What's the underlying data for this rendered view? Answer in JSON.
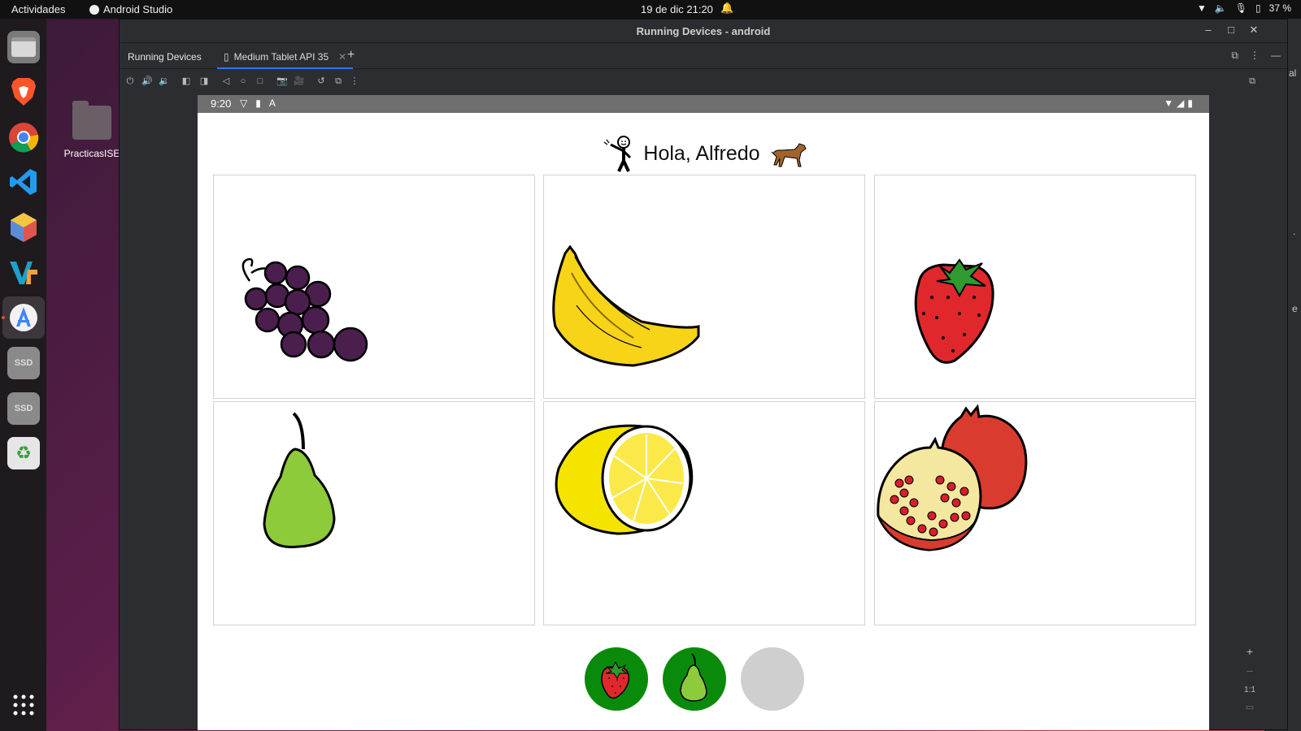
{
  "topbar": {
    "activities": "Actividades",
    "app_name": "Android Studio",
    "clock": "19 de dic  21:20",
    "battery": "37 %"
  },
  "desktop": {
    "folder_label": "PracticasISE"
  },
  "dock": {
    "items": [
      "files",
      "brave",
      "chrome",
      "vscode",
      "gem-app",
      "vs-app",
      "android-studio",
      "ssd-1",
      "ssd-2",
      "trash"
    ],
    "ssd_label": "SSD"
  },
  "window": {
    "title": "Running Devices - android",
    "tab_panel": "Running Devices",
    "tab_device": "Medium Tablet API 35",
    "zoom_actual": "1:1"
  },
  "device": {
    "status_time": "9:20",
    "greeting": "Hola, Alfredo",
    "cards": [
      {
        "fruit": "grapes"
      },
      {
        "fruit": "banana"
      },
      {
        "fruit": "strawberry"
      },
      {
        "fruit": "pear"
      },
      {
        "fruit": "lemon"
      },
      {
        "fruit": "pomegranate"
      }
    ],
    "selection_slots": [
      {
        "state": "filled",
        "fruit": "strawberry"
      },
      {
        "state": "filled",
        "fruit": "pear"
      },
      {
        "state": "empty",
        "fruit": ""
      }
    ]
  },
  "colors": {
    "slot_green": "#0a8a0a",
    "slot_empty": "#cfcfcf",
    "accent_tab": "#3574f0"
  }
}
